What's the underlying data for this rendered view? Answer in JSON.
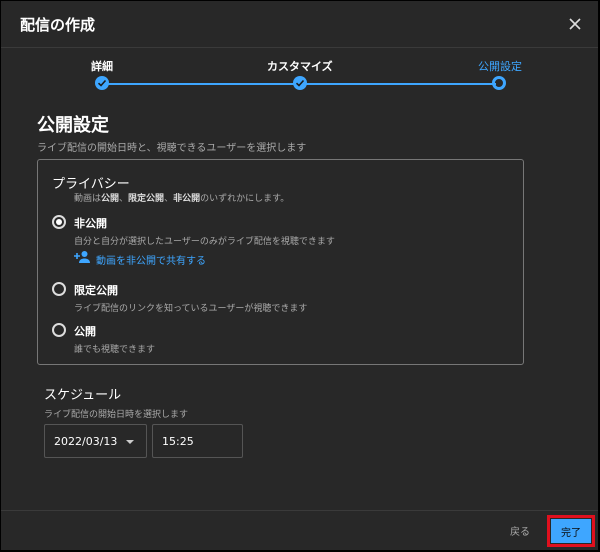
{
  "dialog": {
    "title": "配信の作成"
  },
  "stepper": {
    "steps": [
      {
        "label": "詳細",
        "state": "done"
      },
      {
        "label": "カスタマイズ",
        "state": "done"
      },
      {
        "label": "公開設定",
        "state": "current"
      }
    ]
  },
  "visibility": {
    "title": "公開設定",
    "description": "ライブ配信の開始日時と、視聴できるユーザーを選択します"
  },
  "privacy": {
    "title": "プライバシー",
    "desc_parts": [
      "動画は",
      "公開",
      "、",
      "限定公開",
      "、",
      "非公開",
      "のいずれかにします。"
    ],
    "options": [
      {
        "label": "非公開",
        "sub": "自分と自分が選択したユーザーのみがライブ配信を視聴できます",
        "selected": true
      },
      {
        "label": "限定公開",
        "sub": "ライブ配信のリンクを知っているユーザーが視聴できます",
        "selected": false
      },
      {
        "label": "公開",
        "sub": "誰でも視聴できます",
        "selected": false
      }
    ],
    "share_link": "動画を非公開で共有する"
  },
  "schedule": {
    "title": "スケジュール",
    "description": "ライブ配信の開始日時を選択します",
    "date": "2022/03/13",
    "time": "15:25"
  },
  "footer": {
    "back_label": "戻る",
    "done_label": "完了"
  },
  "colors": {
    "accent": "#3ea6ff",
    "highlight": "#e0101e",
    "background": "#282828"
  }
}
